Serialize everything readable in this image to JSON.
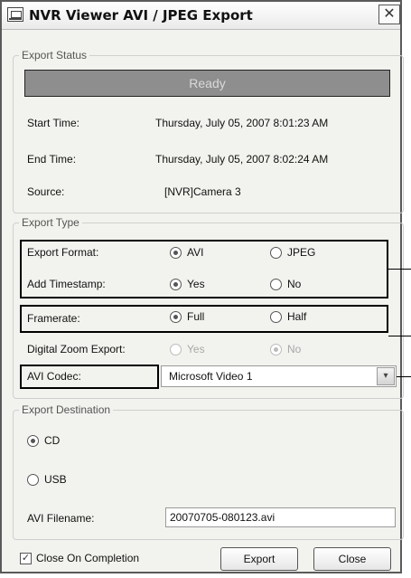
{
  "window": {
    "title": "NVR Viewer AVI / JPEG Export",
    "close_glyph": "✕",
    "icon": "camera-monitor-icon"
  },
  "export_status": {
    "group_label": "Export Status",
    "status_text": "Ready",
    "start_time_label": "Start Time:",
    "start_time_value": "Thursday, July 05, 2007 8:01:23 AM",
    "end_time_label": "End Time:",
    "end_time_value": "Thursday, July 05, 2007 8:02:24 AM",
    "source_label": "Source:",
    "source_value": "[NVR]Camera 3"
  },
  "export_type": {
    "group_label": "Export Type",
    "format_label": "Export Format:",
    "format_options": [
      "AVI",
      "JPEG"
    ],
    "format_selected": "AVI",
    "timestamp_label": "Add Timestamp:",
    "timestamp_options": [
      "Yes",
      "No"
    ],
    "timestamp_selected": "Yes",
    "framerate_label": "Framerate:",
    "framerate_options": [
      "Full",
      "Half"
    ],
    "framerate_selected": "Full",
    "zoom_label": "Digital Zoom Export:",
    "zoom_options": [
      "Yes",
      "No"
    ],
    "zoom_selected": "No",
    "zoom_enabled": false,
    "codec_label": "AVI Codec:",
    "codec_value": "Microsoft Video 1",
    "codec_arrow": "▾"
  },
  "export_destination": {
    "group_label": "Export Destination",
    "options": [
      "CD",
      "USB"
    ],
    "selected": "CD",
    "filename_label": "AVI Filename:",
    "filename_value": "20070705-080123.avi"
  },
  "footer": {
    "close_on_completion_label": "Close On Completion",
    "close_on_completion_checked": true,
    "check_glyph": "✓",
    "export_button": "Export",
    "close_button": "Close"
  }
}
